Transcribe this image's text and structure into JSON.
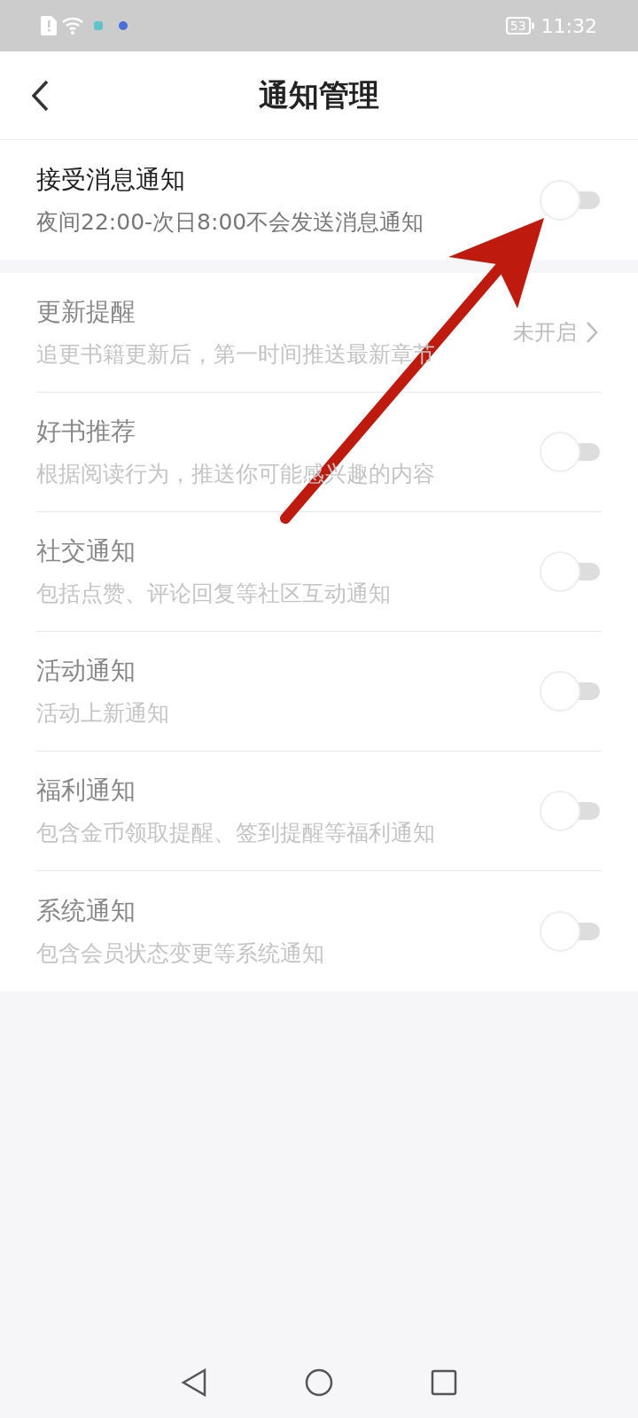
{
  "status_bar": {
    "battery": "53",
    "time": "11:32"
  },
  "header": {
    "title": "通知管理"
  },
  "main_setting": {
    "title": "接受消息通知",
    "subtitle": "夜间22:00-次日8:00不会发送消息通知",
    "on": false
  },
  "settings": [
    {
      "kind": "link",
      "title": "更新提醒",
      "subtitle": "追更书籍更新后，第一时间推送最新章节",
      "value": "未开启",
      "disabled": true
    },
    {
      "kind": "toggle",
      "title": "好书推荐",
      "subtitle": "根据阅读行为，推送你可能感兴趣的内容",
      "on": false,
      "disabled": true
    },
    {
      "kind": "toggle",
      "title": "社交通知",
      "subtitle": "包括点赞、评论回复等社区互动通知",
      "on": false,
      "disabled": true
    },
    {
      "kind": "toggle",
      "title": "活动通知",
      "subtitle": "活动上新通知",
      "on": false,
      "disabled": true
    },
    {
      "kind": "toggle",
      "title": "福利通知",
      "subtitle": "包含金币领取提醒、签到提醒等福利通知",
      "on": false,
      "disabled": true
    },
    {
      "kind": "toggle",
      "title": "系统通知",
      "subtitle": "包含会员状态变更等系统通知",
      "on": false,
      "disabled": true
    }
  ]
}
